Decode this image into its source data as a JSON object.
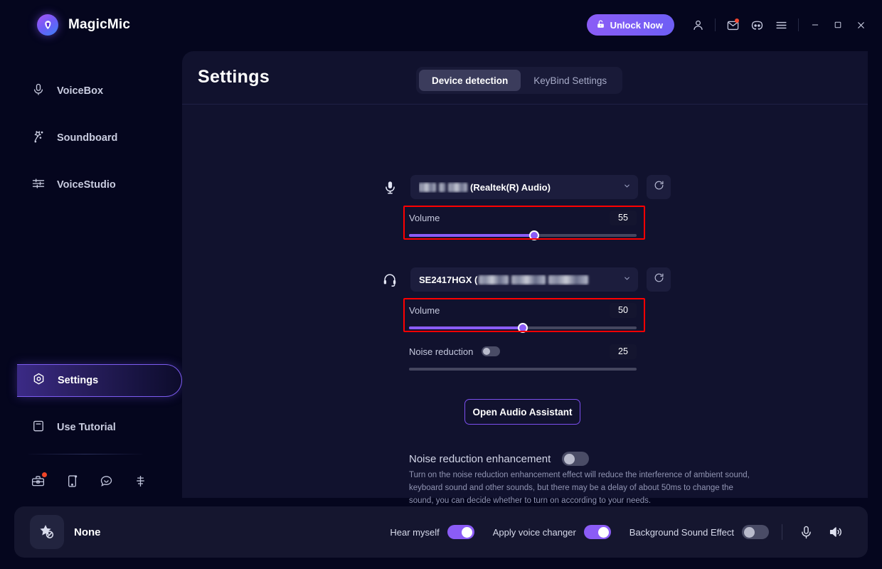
{
  "app": {
    "name": "MagicMic",
    "logo_icon": "magicmic-logo-icon"
  },
  "titlebar": {
    "unlock_label": "Unlock Now",
    "unlock_icon": "lock-open-icon",
    "account_icon": "user-icon",
    "mail_icon": "mail-icon",
    "discord_icon": "discord-icon",
    "menu_icon": "hamburger-menu-icon",
    "minimize_icon": "minimize-icon",
    "maximize_icon": "maximize-icon",
    "close_icon": "close-icon"
  },
  "sidebar": {
    "items": [
      {
        "label": "VoiceBox",
        "icon": "microphone-icon",
        "active": false
      },
      {
        "label": "Soundboard",
        "icon": "magic-wand-icon",
        "active": false
      },
      {
        "label": "VoiceStudio",
        "icon": "sliders-icon",
        "active": false
      },
      {
        "label": "Settings",
        "icon": "gear-hex-icon",
        "active": true
      },
      {
        "label": "Use Tutorial",
        "icon": "book-icon",
        "active": false
      }
    ],
    "footer_icons": [
      {
        "name": "toolbox-icon",
        "badge": true
      },
      {
        "name": "mobile-device-icon",
        "badge": false
      },
      {
        "name": "chat-bubble-icon",
        "badge": false
      },
      {
        "name": "feedback-icon",
        "badge": false
      }
    ]
  },
  "main": {
    "title": "Settings",
    "tabs": [
      {
        "label": "Device detection",
        "active": true
      },
      {
        "label": "KeyBind Settings",
        "active": false
      }
    ],
    "microphone": {
      "icon": "microphone-icon",
      "device_name_masked": "(Realtek(R) Audio)",
      "dropdown_icon": "chevron-down-icon",
      "refresh_icon": "refresh-icon",
      "volume_label": "Volume",
      "volume_value": "55",
      "volume_percent": 55,
      "highlighted": true
    },
    "headphone": {
      "icon": "headset-icon",
      "device_name_prefix": "SE2417HGX (",
      "dropdown_icon": "chevron-down-icon",
      "refresh_icon": "refresh-icon",
      "volume_label": "Volume",
      "volume_value": "50",
      "volume_percent": 50,
      "highlighted": true,
      "noise_reduction_label": "Noise reduction",
      "noise_reduction_value": "25",
      "noise_reduction_on": false,
      "noise_reduction_percent": 0
    },
    "audio_assistant_button": "Open Audio Assistant",
    "noise_reduction_enhancement": {
      "label": "Noise reduction enhancement",
      "enabled": false,
      "description": "Turn on the noise reduction enhancement effect will reduce the interference of ambient sound, keyboard sound and other sounds, but there may be a delay of about 50ms to change the sound, you can decide whether to turn on according to your needs."
    }
  },
  "bottom": {
    "voice_name": "None",
    "voice_icon": "star-none-icon",
    "hear_myself_label": "Hear myself",
    "hear_myself_on": true,
    "apply_voice_changer_label": "Apply voice changer",
    "apply_voice_changer_on": true,
    "background_sound_label": "Background Sound Effect",
    "background_sound_on": false,
    "mic_icon": "microphone-icon",
    "speaker_icon": "speaker-icon"
  },
  "colors": {
    "accent": "#8b5cf6",
    "highlight_box": "#fe0000",
    "panel_bg": "#11122e",
    "app_bg": "#05061e"
  }
}
